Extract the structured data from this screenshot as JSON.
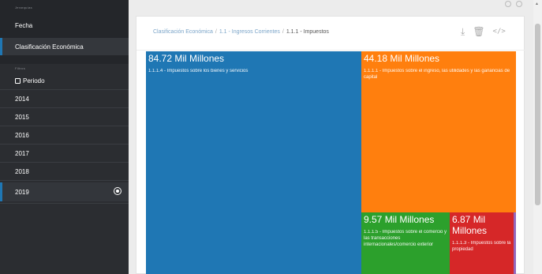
{
  "sidebar": {
    "section_groupings": "Jerarquías",
    "groupings": [
      {
        "label": "Fecha"
      },
      {
        "label": "Clasificación Económica"
      }
    ],
    "section_filters": "Filtros",
    "period_label": "Periodo",
    "years": [
      "2014",
      "2015",
      "2016",
      "2017",
      "2018",
      "2019"
    ],
    "selected_year": "2019"
  },
  "breadcrumb": {
    "items": [
      "Clasificación Económica",
      "1.1 - Ingresos Corrientes",
      "1.1.1 - Impuestos"
    ]
  },
  "toolbar": {
    "download_icon": "download-icon",
    "delete_icon": "trash-icon",
    "embed_label": "</>"
  },
  "treemap": {
    "tiles": [
      {
        "value": "84.72 Mil Millones",
        "label": "1.1.1.4 - Impuestos sobre los bienes y servicios",
        "color": "#1f77b4"
      },
      {
        "value": "44.18 Mil Millones",
        "label": "1.1.1.1 - Impuestos sobre el ingreso, las utilidades y las ganancias de capital",
        "color": "#ff7f0e"
      },
      {
        "value": "9.57 Mil Millones",
        "label": "1.1.1.5 - Impuestos sobre el comercio y las transacciones internacionales/comercio exterior",
        "color": "#2ca02c"
      },
      {
        "value": "6.87 Mil Millones",
        "label": "1.1.1.3 - Impuestos sobre la propiedad",
        "color": "#d62728"
      }
    ]
  }
}
